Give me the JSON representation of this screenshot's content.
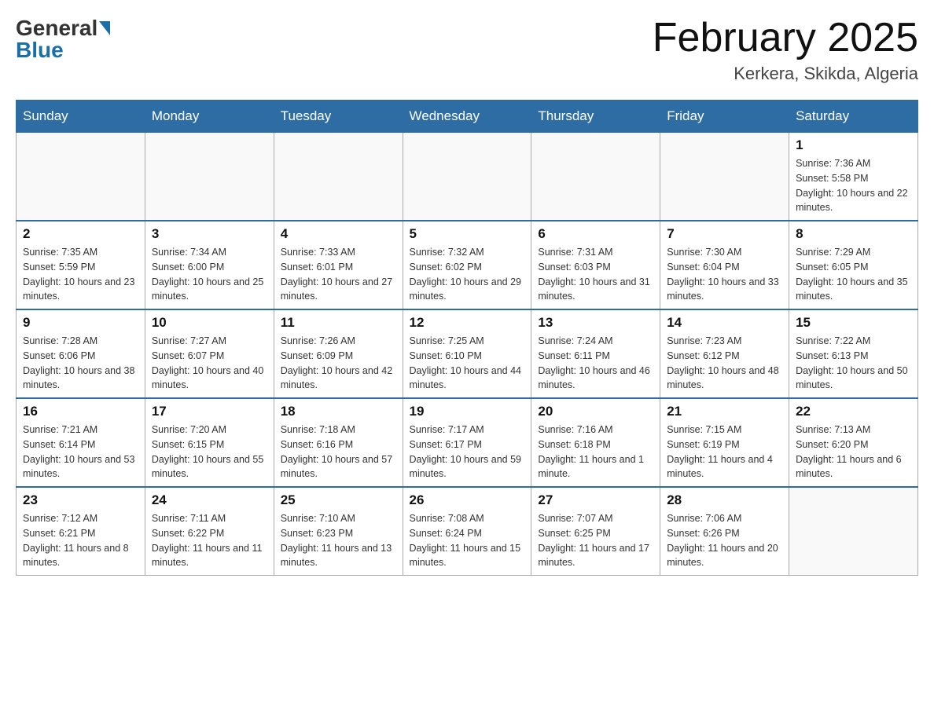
{
  "header": {
    "logo_general": "General",
    "logo_blue": "Blue",
    "month_title": "February 2025",
    "location": "Kerkera, Skikda, Algeria"
  },
  "days_of_week": [
    "Sunday",
    "Monday",
    "Tuesday",
    "Wednesday",
    "Thursday",
    "Friday",
    "Saturday"
  ],
  "weeks": [
    [
      {
        "day": "",
        "info": ""
      },
      {
        "day": "",
        "info": ""
      },
      {
        "day": "",
        "info": ""
      },
      {
        "day": "",
        "info": ""
      },
      {
        "day": "",
        "info": ""
      },
      {
        "day": "",
        "info": ""
      },
      {
        "day": "1",
        "info": "Sunrise: 7:36 AM\nSunset: 5:58 PM\nDaylight: 10 hours and 22 minutes."
      }
    ],
    [
      {
        "day": "2",
        "info": "Sunrise: 7:35 AM\nSunset: 5:59 PM\nDaylight: 10 hours and 23 minutes."
      },
      {
        "day": "3",
        "info": "Sunrise: 7:34 AM\nSunset: 6:00 PM\nDaylight: 10 hours and 25 minutes."
      },
      {
        "day": "4",
        "info": "Sunrise: 7:33 AM\nSunset: 6:01 PM\nDaylight: 10 hours and 27 minutes."
      },
      {
        "day": "5",
        "info": "Sunrise: 7:32 AM\nSunset: 6:02 PM\nDaylight: 10 hours and 29 minutes."
      },
      {
        "day": "6",
        "info": "Sunrise: 7:31 AM\nSunset: 6:03 PM\nDaylight: 10 hours and 31 minutes."
      },
      {
        "day": "7",
        "info": "Sunrise: 7:30 AM\nSunset: 6:04 PM\nDaylight: 10 hours and 33 minutes."
      },
      {
        "day": "8",
        "info": "Sunrise: 7:29 AM\nSunset: 6:05 PM\nDaylight: 10 hours and 35 minutes."
      }
    ],
    [
      {
        "day": "9",
        "info": "Sunrise: 7:28 AM\nSunset: 6:06 PM\nDaylight: 10 hours and 38 minutes."
      },
      {
        "day": "10",
        "info": "Sunrise: 7:27 AM\nSunset: 6:07 PM\nDaylight: 10 hours and 40 minutes."
      },
      {
        "day": "11",
        "info": "Sunrise: 7:26 AM\nSunset: 6:09 PM\nDaylight: 10 hours and 42 minutes."
      },
      {
        "day": "12",
        "info": "Sunrise: 7:25 AM\nSunset: 6:10 PM\nDaylight: 10 hours and 44 minutes."
      },
      {
        "day": "13",
        "info": "Sunrise: 7:24 AM\nSunset: 6:11 PM\nDaylight: 10 hours and 46 minutes."
      },
      {
        "day": "14",
        "info": "Sunrise: 7:23 AM\nSunset: 6:12 PM\nDaylight: 10 hours and 48 minutes."
      },
      {
        "day": "15",
        "info": "Sunrise: 7:22 AM\nSunset: 6:13 PM\nDaylight: 10 hours and 50 minutes."
      }
    ],
    [
      {
        "day": "16",
        "info": "Sunrise: 7:21 AM\nSunset: 6:14 PM\nDaylight: 10 hours and 53 minutes."
      },
      {
        "day": "17",
        "info": "Sunrise: 7:20 AM\nSunset: 6:15 PM\nDaylight: 10 hours and 55 minutes."
      },
      {
        "day": "18",
        "info": "Sunrise: 7:18 AM\nSunset: 6:16 PM\nDaylight: 10 hours and 57 minutes."
      },
      {
        "day": "19",
        "info": "Sunrise: 7:17 AM\nSunset: 6:17 PM\nDaylight: 10 hours and 59 minutes."
      },
      {
        "day": "20",
        "info": "Sunrise: 7:16 AM\nSunset: 6:18 PM\nDaylight: 11 hours and 1 minute."
      },
      {
        "day": "21",
        "info": "Sunrise: 7:15 AM\nSunset: 6:19 PM\nDaylight: 11 hours and 4 minutes."
      },
      {
        "day": "22",
        "info": "Sunrise: 7:13 AM\nSunset: 6:20 PM\nDaylight: 11 hours and 6 minutes."
      }
    ],
    [
      {
        "day": "23",
        "info": "Sunrise: 7:12 AM\nSunset: 6:21 PM\nDaylight: 11 hours and 8 minutes."
      },
      {
        "day": "24",
        "info": "Sunrise: 7:11 AM\nSunset: 6:22 PM\nDaylight: 11 hours and 11 minutes."
      },
      {
        "day": "25",
        "info": "Sunrise: 7:10 AM\nSunset: 6:23 PM\nDaylight: 11 hours and 13 minutes."
      },
      {
        "day": "26",
        "info": "Sunrise: 7:08 AM\nSunset: 6:24 PM\nDaylight: 11 hours and 15 minutes."
      },
      {
        "day": "27",
        "info": "Sunrise: 7:07 AM\nSunset: 6:25 PM\nDaylight: 11 hours and 17 minutes."
      },
      {
        "day": "28",
        "info": "Sunrise: 7:06 AM\nSunset: 6:26 PM\nDaylight: 11 hours and 20 minutes."
      },
      {
        "day": "",
        "info": ""
      }
    ]
  ]
}
